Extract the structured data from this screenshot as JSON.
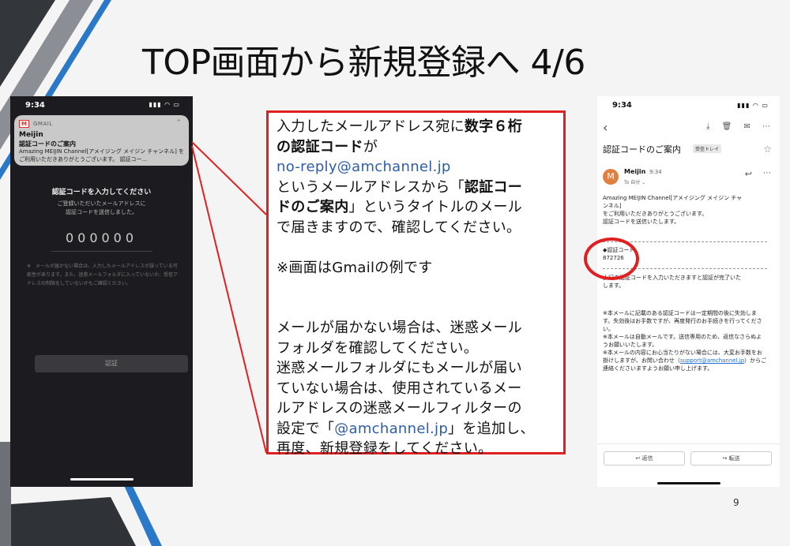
{
  "slide": {
    "title": "TOP画面から新規登録へ 4/6",
    "page_number": "9"
  },
  "phone_left": {
    "status_time": "9:34",
    "status_icons": "▮▮▮ ◠ ▭",
    "notification": {
      "app_icon": "M",
      "app_name": "GMAIL",
      "more": "⌃",
      "sender": "Meijin",
      "subject": "認証コードのご案内",
      "body": "Amazing MEIJIN Channel[アメイジング メイジン チャンネル] をご利用いただきありがとうございます。 認証コー..."
    },
    "heading": "認証コードを入力してください",
    "sub_line1": "ご登録いただいたメールアドレスに",
    "sub_line2": "認証コードを送信しました。",
    "code_placeholder": "000000",
    "note": "※　メールが届かない場合は、入力したメールアドレスが誤っている可能性があります。また、迷惑メールフォルダに入っていないか、受信アドレスの制限をしていないかもご確認ください。",
    "submit_button": "認証"
  },
  "info_box": {
    "l1a": "入力したメールアドレス宛に",
    "l1b": "数字６桁",
    "l2a": "の認証コード",
    "l2b": "が",
    "l3": "no-reply@amchannel.jp",
    "l4a": "というメールアドレスから「",
    "l4b": "認証コー",
    "l5a": "ドのご案内",
    "l5b": "」というタイトルのメール",
    "l6": "で届きますので、確認してください。",
    "l7": "※画面はGmailの例です",
    "l8": "メールが届かない場合は、迷惑メール",
    "l9": "フォルダを確認してください。",
    "l10": "迷惑メールフォルダにもメールが届い",
    "l11": "ていない場合は、使用されているメー",
    "l12": "ルアドレスの迷惑メールフィルターの",
    "l13a": "設定で「",
    "l13b": "@amchannel.jp",
    "l13c": "」を追加し、",
    "l14": "再度、新規登録をしてください。"
  },
  "phone_right": {
    "status_time": "9:34",
    "status_icons": "▮▮▮ ◠ ▭",
    "back": "‹",
    "toolbar_icons": "⤓ 🗑 ✉ ⋯",
    "subject": "認証コードのご案内",
    "label": "受信トレイ",
    "star": "☆",
    "avatar_letter": "M",
    "sender": "Meijin",
    "sent_time": "9:34",
    "to": "To 自分 ⌄",
    "reply_icon": "↩",
    "more_icon": "⋯",
    "body_line1": "Amazing MEIJIN Channel[アメイジング メイジン チャ",
    "body_line2": "ンネル]",
    "body_line3": "をご利用いただきありがとうございます。",
    "body_line4": "認証コードを送信いたします。",
    "code_label": "◆認証コード",
    "code_value": "872726",
    "after_line1": "上記の認証コードを入力いただきますと認証が完了いた",
    "after_line2": "します。",
    "notes1": "※本メールに記載のある認証コードは一定期間の後に失効します。失効後はお手数ですが、再度発行のお手続きを行ってください。",
    "notes2": "※本メールは自動メールです。送信専用のため、返信なさらぬようお願いいたします。",
    "notes3a": "※本メールの内容にお心当たりがない場合には、大変お手数をお掛けしますが、お問い合わせ（",
    "notes3b": "support@amchannel.jp",
    "notes3c": "）からご連絡くださいますようお願い申し上げます。",
    "reply_button": "↩ 返信",
    "forward_button": "↪ 転送"
  },
  "colors": {
    "accent_red": "#e02020",
    "link_blue": "#2e5da8",
    "deco_dark": "#2d2f33",
    "deco_blue": "#2a78c8"
  }
}
